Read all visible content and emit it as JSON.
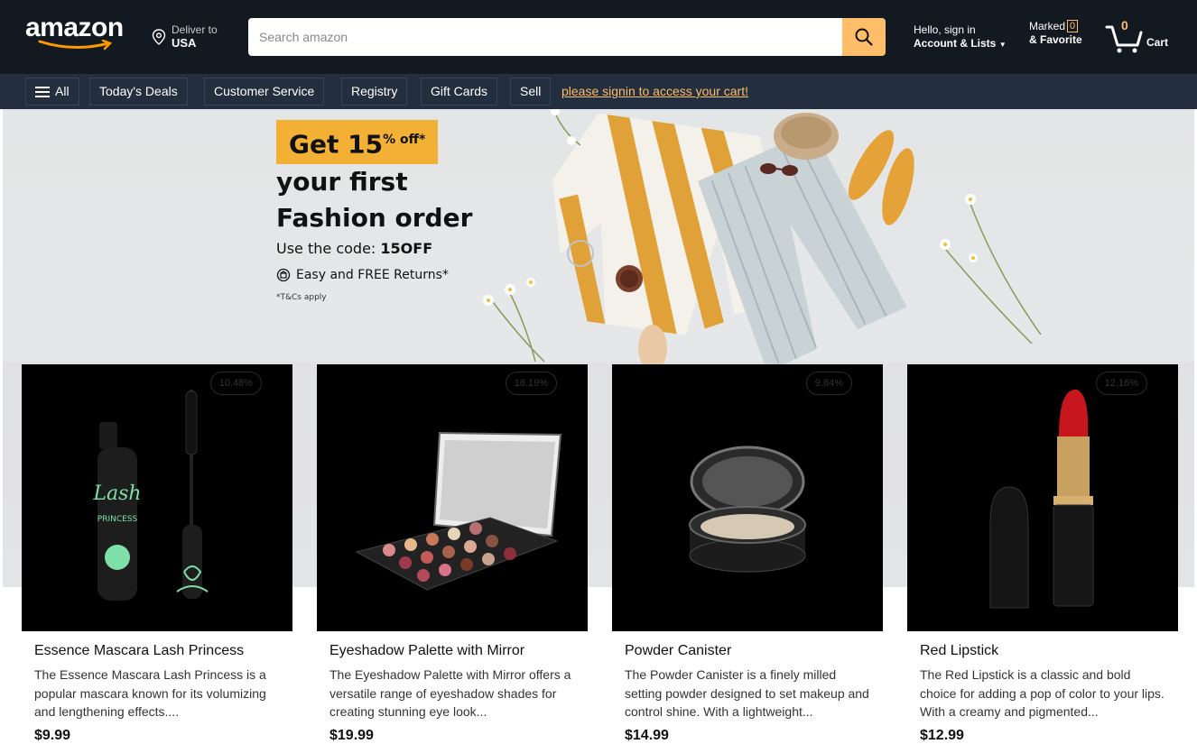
{
  "header": {
    "logo_text": "amazon",
    "deliver_label": "Deliver to",
    "deliver_location": "USA",
    "search_placeholder": "Search amazon",
    "account_greeting": "Hello, sign in",
    "account_label": "Account & Lists",
    "marked_label": "Marked",
    "marked_count": "0",
    "favorite_label": "& Favorite",
    "cart_count": "0",
    "cart_label": "Cart"
  },
  "subnav": {
    "all_label": "All",
    "items": [
      "Today's Deals",
      "Customer Service",
      "Registry",
      "Gift Cards",
      "Sell"
    ],
    "signin_link": "please signin to access your cart!"
  },
  "hero": {
    "badge_main": "Get 15",
    "badge_sup": "% off*",
    "line1": "your first",
    "line2": "Fashion order",
    "code_prefix": "Use the code: ",
    "code": "15OFF",
    "returns": "Easy and FREE Returns*",
    "tcs": "*T&Cs apply"
  },
  "products": [
    {
      "title": "Essence Mascara Lash Princess",
      "description": "The Essence Mascara Lash Princess is a popular mascara known for its volumizing and lengthening effects....",
      "price": "$9.99",
      "discount": "10.48%",
      "icon": "mascara-icon"
    },
    {
      "title": "Eyeshadow Palette with Mirror",
      "description": "The Eyeshadow Palette with Mirror offers a versatile range of eyeshadow shades for creating stunning eye look...",
      "price": "$19.99",
      "discount": "18.19%",
      "icon": "eyeshadow-palette-icon"
    },
    {
      "title": "Powder Canister",
      "description": "The Powder Canister is a finely milled setting powder designed to set makeup and control shine. With a lightweight...",
      "price": "$14.99",
      "discount": "9.84%",
      "icon": "powder-compact-icon"
    },
    {
      "title": "Red Lipstick",
      "description": "The Red Lipstick is a classic and bold choice for adding a pop of color to your lips. With a creamy and pigmented...",
      "price": "$12.99",
      "discount": "12.16%",
      "icon": "lipstick-icon"
    }
  ],
  "colors": {
    "nav_dark": "#131921",
    "nav_sub": "#232f3e",
    "accent": "#febd69",
    "badge": "#f2b134"
  }
}
